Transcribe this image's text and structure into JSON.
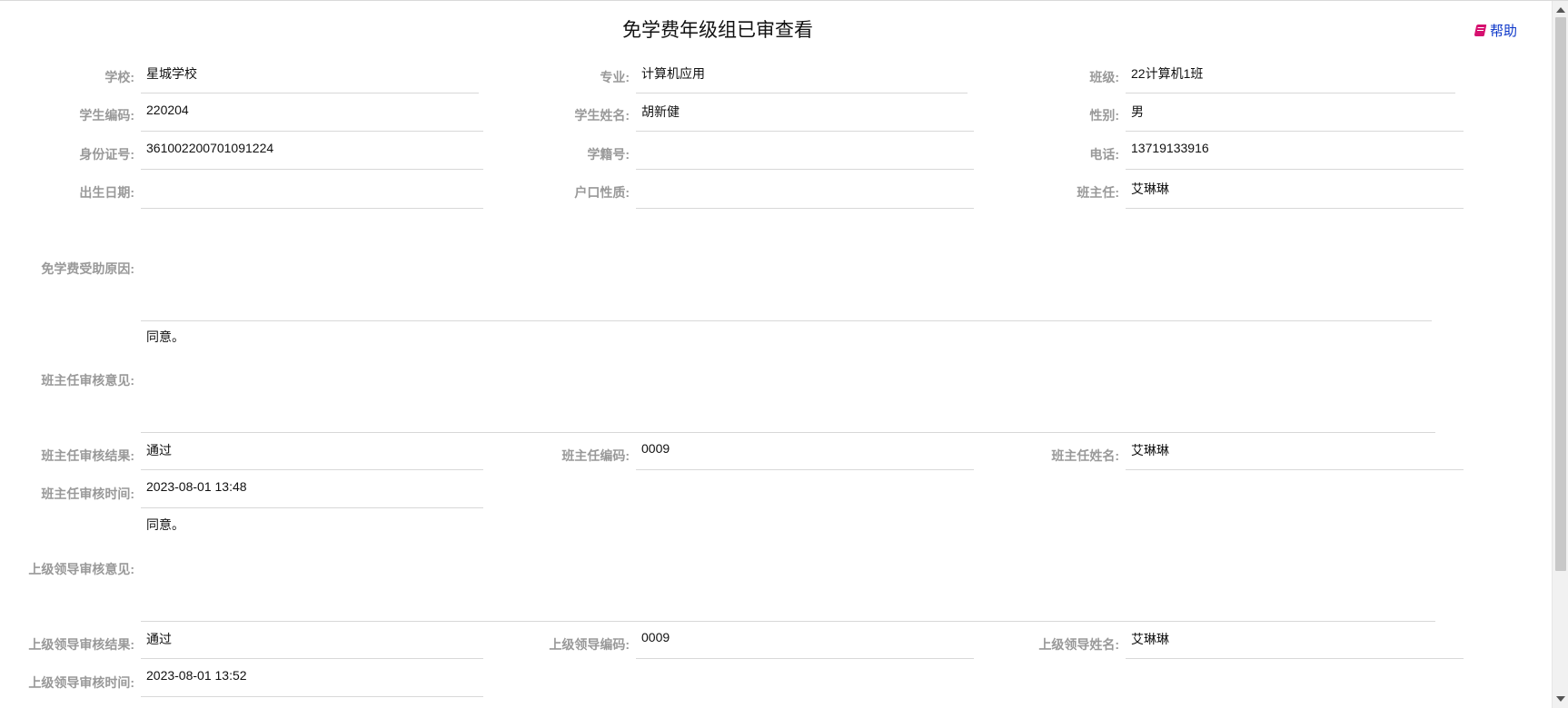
{
  "header": {
    "title": "免学费年级组已审查看",
    "help_label": "帮助",
    "help_icon": "book-icon"
  },
  "fields": {
    "school_label": "学校:",
    "school_value": "星城学校",
    "major_label": "专业:",
    "major_value": "计算机应用",
    "class_label": "班级:",
    "class_value": "22计算机1班",
    "student_code_label": "学生编码:",
    "student_code_value": "220204",
    "student_name_label": "学生姓名:",
    "student_name_value": "胡新健",
    "gender_label": "性别:",
    "gender_value": "男",
    "id_number_label": "身份证号:",
    "id_number_value": "361002200701091224",
    "enrollment_no_label": "学籍号:",
    "enrollment_no_value": "",
    "phone_label": "电话:",
    "phone_value": "13719133916",
    "birth_date_label": "出生日期:",
    "birth_date_value": "",
    "household_label": "户口性质:",
    "household_value": "",
    "head_teacher_label": "班主任:",
    "head_teacher_value": "艾琳琳",
    "reason_label": "免学费受助原因:",
    "reason_value": "",
    "teacher_opinion_label": "班主任审核意见:",
    "teacher_opinion_value": "同意。",
    "teacher_result_label": "班主任审核结果:",
    "teacher_result_value": "通过",
    "teacher_code_label": "班主任编码:",
    "teacher_code_value": "0009",
    "teacher_name_label": "班主任姓名:",
    "teacher_name_value": "艾琳琳",
    "teacher_time_label": "班主任审核时间:",
    "teacher_time_value": "2023-08-01 13:48",
    "leader_opinion_label": "上级领导审核意见:",
    "leader_opinion_value": "同意。",
    "leader_result_label": "上级领导审核结果:",
    "leader_result_value": "通过",
    "leader_code_label": "上级领导编码:",
    "leader_code_value": "0009",
    "leader_name_label": "上级领导姓名:",
    "leader_name_value": "艾琳琳",
    "leader_time_label": "上级领导审核时间:",
    "leader_time_value": "2023-08-01 13:52"
  }
}
